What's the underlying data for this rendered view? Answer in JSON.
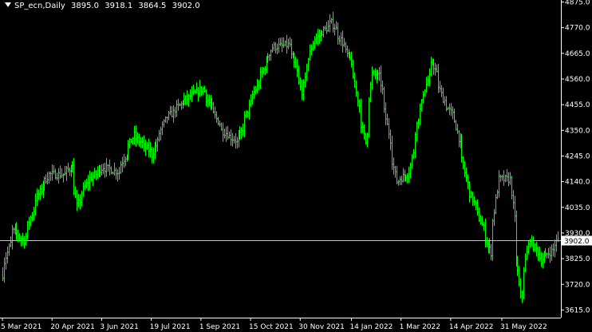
{
  "header": {
    "symbol": "SP_ecn,Daily",
    "open": "3895.0",
    "high": "3918.1",
    "low": "3864.5",
    "close": "3902.0"
  },
  "colors": {
    "background": "#000000",
    "bars": "#00ff00",
    "axis": "#ffffff",
    "price_line": "#c0c0c0"
  },
  "chart_data": {
    "type": "ohlc",
    "y_ticks": [
      "4875.0",
      "4770.0",
      "4665.0",
      "4560.0",
      "4455.0",
      "4350.0",
      "4245.0",
      "4140.0",
      "4035.0",
      "3930.0",
      "3825.0",
      "3720.0",
      "3615.0"
    ],
    "ylim": [
      3600,
      4880
    ],
    "x_ticks": [
      "5 Mar 2021",
      "20 Apr 2021",
      "3 Jun 2021",
      "19 Jul 2021",
      "1 Sep 2021",
      "15 Oct 2021",
      "30 Nov 2021",
      "14 Jan 2022",
      "1 Mar 2022",
      "14 Apr 2022",
      "31 May 2022"
    ],
    "current_price": 3902.0,
    "current_price_label": "3902.0",
    "anchors": [
      [
        "2021-03-05",
        3760
      ],
      [
        "2021-03-15",
        3940
      ],
      [
        "2021-03-25",
        3900
      ],
      [
        "2021-04-05",
        4070
      ],
      [
        "2021-04-16",
        4170
      ],
      [
        "2021-04-30",
        4170
      ],
      [
        "2021-05-07",
        4200
      ],
      [
        "2021-05-12",
        4040
      ],
      [
        "2021-05-21",
        4140
      ],
      [
        "2021-06-04",
        4200
      ],
      [
        "2021-06-18",
        4180
      ],
      [
        "2021-07-02",
        4330
      ],
      [
        "2021-07-19",
        4250
      ],
      [
        "2021-07-30",
        4390
      ],
      [
        "2021-08-16",
        4470
      ],
      [
        "2021-09-02",
        4520
      ],
      [
        "2021-09-20",
        4350
      ],
      [
        "2021-10-04",
        4300
      ],
      [
        "2021-10-15",
        4460
      ],
      [
        "2021-11-04",
        4690
      ],
      [
        "2021-11-19",
        4700
      ],
      [
        "2021-12-01",
        4510
      ],
      [
        "2021-12-10",
        4710
      ],
      [
        "2021-12-28",
        4790
      ],
      [
        "2022-01-05",
        4720
      ],
      [
        "2022-01-14",
        4630
      ],
      [
        "2022-01-27",
        4300
      ],
      [
        "2022-02-02",
        4580
      ],
      [
        "2022-02-09",
        4570
      ],
      [
        "2022-02-24",
        4140
      ],
      [
        "2022-03-08",
        4180
      ],
      [
        "2022-03-18",
        4460
      ],
      [
        "2022-03-29",
        4630
      ],
      [
        "2022-04-07",
        4480
      ],
      [
        "2022-04-18",
        4390
      ],
      [
        "2022-04-29",
        4130
      ],
      [
        "2022-05-10",
        3990
      ],
      [
        "2022-05-20",
        3850
      ],
      [
        "2022-05-27",
        4150
      ],
      [
        "2022-06-07",
        4150
      ],
      [
        "2022-06-16",
        3660
      ],
      [
        "2022-06-24",
        3910
      ],
      [
        "2022-07-05",
        3820
      ],
      [
        "2022-07-15",
        3860
      ],
      [
        "2022-07-20",
        3902
      ]
    ]
  }
}
